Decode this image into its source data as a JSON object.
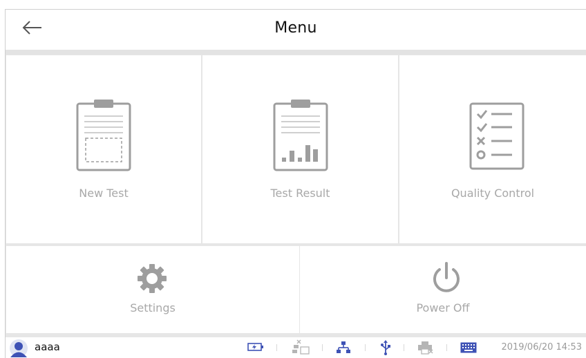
{
  "header": {
    "title": "Menu",
    "back_icon": "arrow-left-icon"
  },
  "tiles": {
    "new_test": {
      "label": "New Test",
      "icon": "clipboard-icon"
    },
    "test_result": {
      "label": "Test Result",
      "icon": "clipboard-chart-icon"
    },
    "quality_control": {
      "label": "Quality Control",
      "icon": "checklist-icon"
    },
    "settings": {
      "label": "Settings",
      "icon": "gear-icon"
    },
    "power_off": {
      "label": "Power Off",
      "icon": "power-icon"
    }
  },
  "status_bar": {
    "username": "aaaa",
    "icons": [
      "user-avatar-icon",
      "battery-charging-icon",
      "network-disconnected-icon",
      "network-icon",
      "usb-icon",
      "printer-disconnected-icon",
      "keyboard-icon"
    ],
    "datetime": "2019/06/20 14:53"
  },
  "colors": {
    "icon_gray": "#9e9e9e",
    "label_gray": "#a8a8a8",
    "status_blue": "#3e52b5"
  }
}
